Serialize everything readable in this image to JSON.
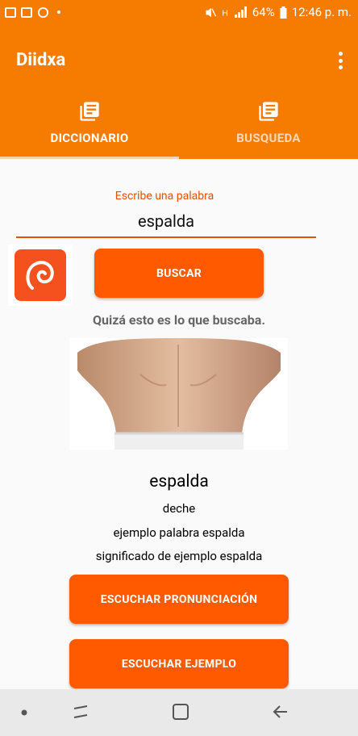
{
  "status_bar": {
    "battery": "64%",
    "time": "12:46 p. m."
  },
  "app_bar": {
    "title": "Diidxa"
  },
  "tabs": [
    {
      "label": "DICCIONARIO",
      "selected": true
    },
    {
      "label": "BUSQUEDA",
      "selected": false
    }
  ],
  "search": {
    "label": "Escribe una palabra",
    "value": "espalda",
    "button_label": "BUSCAR"
  },
  "hint": "Quizá esto es lo que buscaba.",
  "result": {
    "word": "espalda",
    "translation": "deche",
    "example": "ejemplo palabra espalda",
    "meaning": "significado de ejemplo espalda"
  },
  "actions": {
    "pronunciation_label": "ESCUCHAR PRONUNCIACIÓN",
    "example_label": "ESCUCHAR EJEMPLO"
  },
  "colors": {
    "primary": "#f57c00",
    "button": "#ff5a00",
    "accent_text": "#e65100"
  }
}
